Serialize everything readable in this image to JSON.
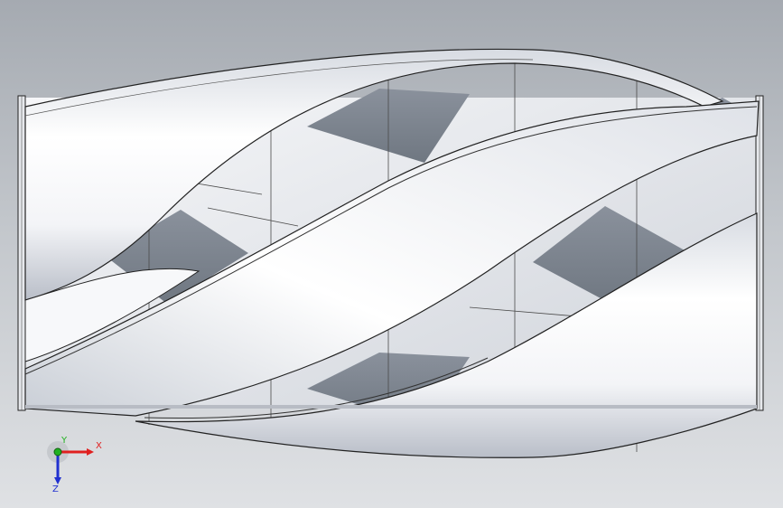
{
  "viewport": {
    "description_colors": {
      "background_top": "#a5aab1",
      "background_bottom": "#dfe1e4",
      "surface_light": "#ffffff",
      "surface_shade": "#c8ccd3",
      "cavity_dark": "#7f8792",
      "edge_line": "#2b2b2b"
    }
  },
  "triad": {
    "x_label": "X",
    "y_label": "Y",
    "z_label": "Z",
    "x_color": "#e02020",
    "y_color": "#20b020",
    "z_color": "#2030d0"
  }
}
